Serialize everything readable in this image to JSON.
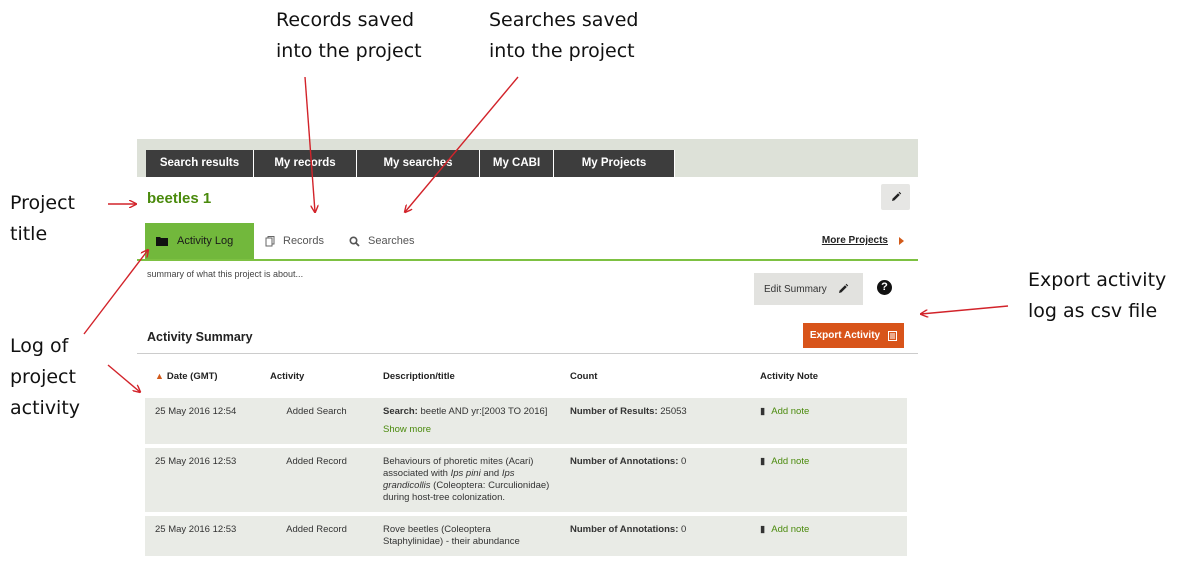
{
  "annotations": {
    "records_saved": [
      "Records saved",
      "into the project"
    ],
    "searches_saved": [
      "Searches saved",
      "into the project"
    ],
    "project_title": [
      "Project",
      "title"
    ],
    "log": [
      "Log of",
      "project",
      "activity"
    ],
    "export": [
      "Export activity",
      "log as csv file"
    ]
  },
  "nav": {
    "tabs": [
      "Search results",
      "My records",
      "My searches",
      "My CABI",
      "My Projects"
    ]
  },
  "project": {
    "title": "beetles 1",
    "summary": "summary of what this project is about..."
  },
  "subtabs": {
    "activity": "Activity Log",
    "records": "Records",
    "searches": "Searches",
    "more": "More Projects"
  },
  "buttons": {
    "edit_summary": "Edit Summary",
    "export": "Export Activity",
    "help": "?"
  },
  "activity": {
    "heading": "Activity Summary",
    "columns": {
      "date": "Date (GMT)",
      "activity": "Activity",
      "description": "Description/title",
      "count": "Count",
      "note": "Activity Note"
    },
    "rows": [
      {
        "date": "25 May 2016 12:54",
        "activity": "Added Search",
        "desc_label": "Search:",
        "desc": "beetle AND yr:[2003 TO 2016]",
        "show_more": "Show more",
        "count_label": "Number of Results:",
        "count": "25053",
        "note": "Add note"
      },
      {
        "date": "25 May 2016 12:53",
        "activity": "Added Record",
        "desc_a": "Behaviours of phoretic mites (Acari) associated with",
        "desc_b": "Ips pini",
        "desc_c": "and",
        "desc_d": "Ips grandicollis",
        "desc_e": "(Coleoptera: Curculionidae) during host-tree colonization.",
        "count_label": "Number of Annotations:",
        "count": "0",
        "note": "Add note"
      },
      {
        "date": "25 May 2016 12:53",
        "activity": "Added Record",
        "desc": "Rove beetles (Coleoptera Staphylinidae) - their abundance",
        "count_label": "Number of Annotations:",
        "count": "0",
        "note": "Add note"
      }
    ]
  },
  "colors": {
    "green": "#72b83c",
    "title_green": "#4a8a0c",
    "export_orange": "#d8541a",
    "arrow_red": "#d2232a"
  }
}
